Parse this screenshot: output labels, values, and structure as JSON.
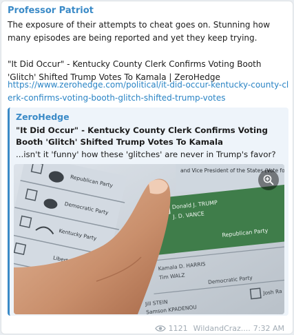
{
  "message": {
    "author": "Professor Patriot",
    "text": "The exposure of their attempts to cheat goes on.  Stunning how many episodes are being reported and yet they keep trying.\n\n\"It Did Occur\" - Kentucky County Clerk Confirms Voting Booth 'Glitch' Shifted Trump Votes To Kamala | ZeroHedge",
    "link": "https://www.zerohedge.com/political/it-did-occur-kentucky-county-clerk-confirms-voting-booth-glitch-shifted-trump-votes"
  },
  "preview": {
    "site": "ZeroHedge",
    "title": "\"It Did Occur\" - Kentucky County Clerk Confirms Voting Booth 'Glitch' Shifted Trump Votes To Kamala",
    "description": "...isn't it 'funny' how these 'glitches' are never in Trump's favor?",
    "ballot": {
      "header": "and Vice President of the States (Vote for one)",
      "left_parties": [
        "Republican Party",
        "Democratic Party",
        "Kentucky Party",
        "Libertarian"
      ],
      "candidates": [
        {
          "name": "Donald J. TRUMP",
          "running_mate": "J. D. VANCE",
          "party": "Republican Party"
        },
        {
          "name": "Kamala D. HARRIS",
          "running_mate": "Tim WALZ",
          "party": "Democratic Party"
        },
        {
          "name": "Jill STEIN",
          "running_mate": "Samson KPADENOU",
          "party": ""
        }
      ],
      "other_label": "Josh Ra"
    }
  },
  "footer": {
    "views": "1121",
    "signature": "WildandCraz....",
    "time": "7:32 AM"
  },
  "colors": {
    "accent": "#3a8ac7",
    "republican_green": "#3f7d4a"
  },
  "icons": [
    "zoom-in-icon",
    "eye-icon"
  ]
}
